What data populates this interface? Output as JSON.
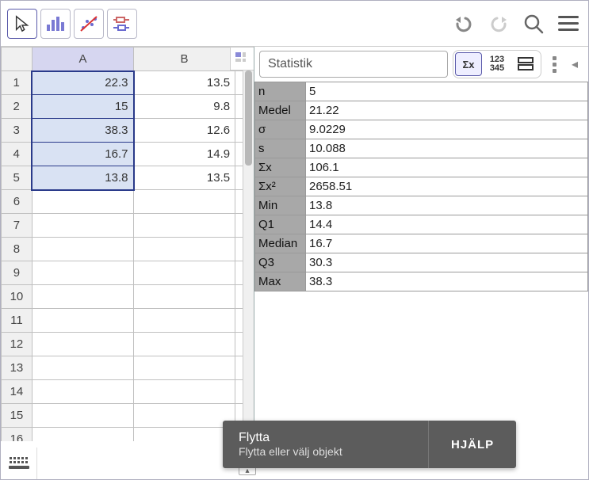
{
  "toolbar": {
    "icons": [
      "pointer",
      "bar-chart",
      "scatter-no",
      "boxplot"
    ]
  },
  "spreadsheet": {
    "columns": [
      "A",
      "B"
    ],
    "rows": 16,
    "data": {
      "A": [
        "22.3",
        "15",
        "38.3",
        "16.7",
        "13.8"
      ],
      "B": [
        "13.5",
        "9.8",
        "12.6",
        "14.9",
        "13.5"
      ]
    },
    "selection": {
      "col": "A",
      "from": 1,
      "to": 5
    }
  },
  "stats_panel": {
    "title": "Statistik",
    "rows": [
      {
        "label": "n",
        "value": "5"
      },
      {
        "label": "Medel",
        "value": "21.22"
      },
      {
        "label": "σ",
        "value": "9.0229"
      },
      {
        "label": "s",
        "value": "10.088"
      },
      {
        "label": "Σx",
        "value": "106.1"
      },
      {
        "label": "Σx²",
        "value": "2658.51"
      },
      {
        "label": "Min",
        "value": "13.8"
      },
      {
        "label": "Q1",
        "value": "14.4"
      },
      {
        "label": "Median",
        "value": "16.7"
      },
      {
        "label": "Q3",
        "value": "30.3"
      },
      {
        "label": "Max",
        "value": "38.3"
      }
    ]
  },
  "tooltip": {
    "title": "Flytta",
    "subtitle": "Flytta eller välj objekt",
    "help": "HJÄLP"
  }
}
